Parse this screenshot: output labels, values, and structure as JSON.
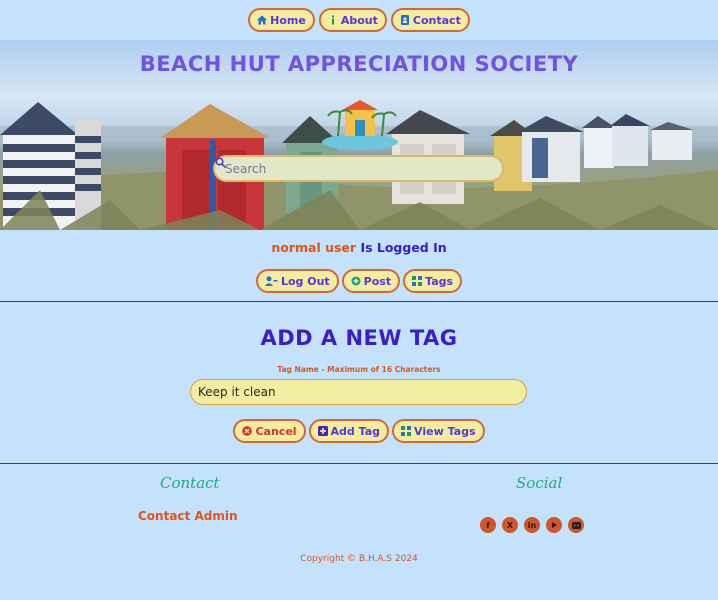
{
  "nav": {
    "home": "Home",
    "about": "About",
    "contact": "Contact"
  },
  "hero": {
    "title": "BEACH HUT APPRECIATION SOCIETY",
    "search_placeholder": "Search"
  },
  "status": {
    "username": "normal user",
    "suffix": "Is Logged In"
  },
  "user_actions": {
    "logout": "Log Out",
    "post": "Post",
    "tags": "Tags"
  },
  "form": {
    "title": "ADD A NEW TAG",
    "label": "Tag Name - Maximum of 16 Characters",
    "value": "Keep it clean",
    "cancel": "Cancel",
    "add": "Add Tag",
    "view": "View Tags"
  },
  "footer": {
    "contact_heading": "Contact",
    "contact_link": "Contact Admin",
    "social_heading": "Social",
    "socials": [
      "facebook-icon",
      "x-icon",
      "linkedin-icon",
      "youtube-icon",
      "discord-icon"
    ],
    "copyright": "Copyright © B.H.A.S 2024"
  },
  "colors": {
    "background": "#c4e2fb",
    "pill": "#f2eda0",
    "pill_border": "#d2683a",
    "accent": "#3a1fc6",
    "orange": "#e2531b"
  }
}
